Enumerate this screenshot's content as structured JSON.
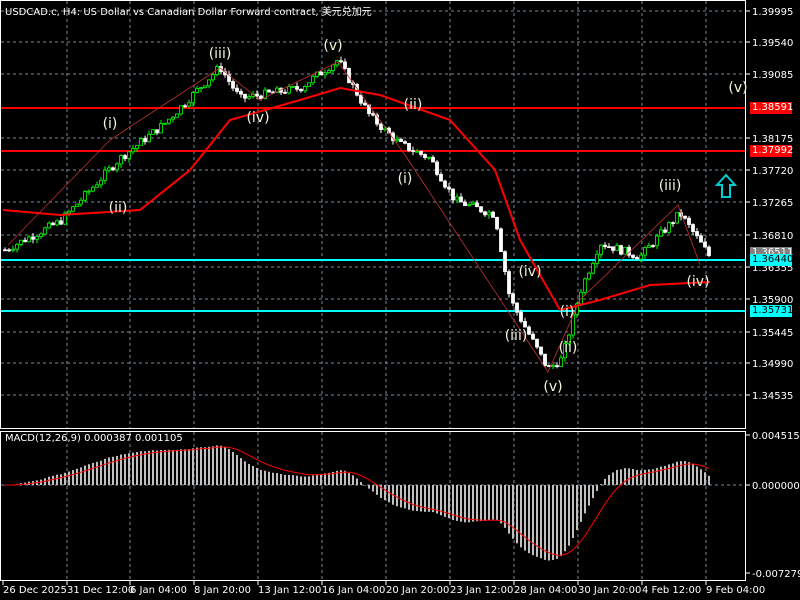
{
  "header": {
    "title": "USDCAD.c, H4:  US Dollar vs Canadian Dollar Forward contract, 美元兑加元"
  },
  "price_axis": [
    "1.39995",
    "1.39540",
    "1.39085",
    "1.38175",
    "1.37720",
    "1.37265",
    "1.36810",
    "1.36355",
    "1.35900",
    "1.35445",
    "1.34990",
    "1.34535"
  ],
  "price_tags": {
    "red1": "1.38591",
    "red2": "1.37992",
    "bid": "1.36511",
    "cyan1": "1.36440",
    "cyan2": "1.35731"
  },
  "macd": {
    "label": "MACD(12,26,9) 0.000387 0.001105",
    "axis": [
      "0.004515",
      "0.000000",
      "-0.007279"
    ]
  },
  "time_axis": [
    "26 Dec 2025",
    "31 Dec 12:00",
    "6 Jan 04:00",
    "8 Jan 20:00",
    "13 Jan 12:00",
    "16 Jan 04:00",
    "20 Jan 20:00",
    "23 Jan 12:00",
    "28 Jan 04:00",
    "30 Jan 20:00",
    "4 Feb 12:00",
    "9 Feb 04:00"
  ],
  "wave_labels": [
    "(iii)",
    "(v)",
    "(i)",
    "(ii)",
    "(iv)",
    "(ii)",
    "(i)",
    "(iv)",
    "(iii)",
    "(i)",
    "(ii)",
    "(v)",
    "(iii)",
    "(iv)",
    "(v)"
  ],
  "colors": {
    "up": "#00ff00",
    "down": "#ffffff",
    "ma": "#ff0000",
    "level_red": "#ff0000",
    "level_cyan": "#00ffff",
    "grid": "#778899",
    "hist": "#c0c0c0"
  }
}
